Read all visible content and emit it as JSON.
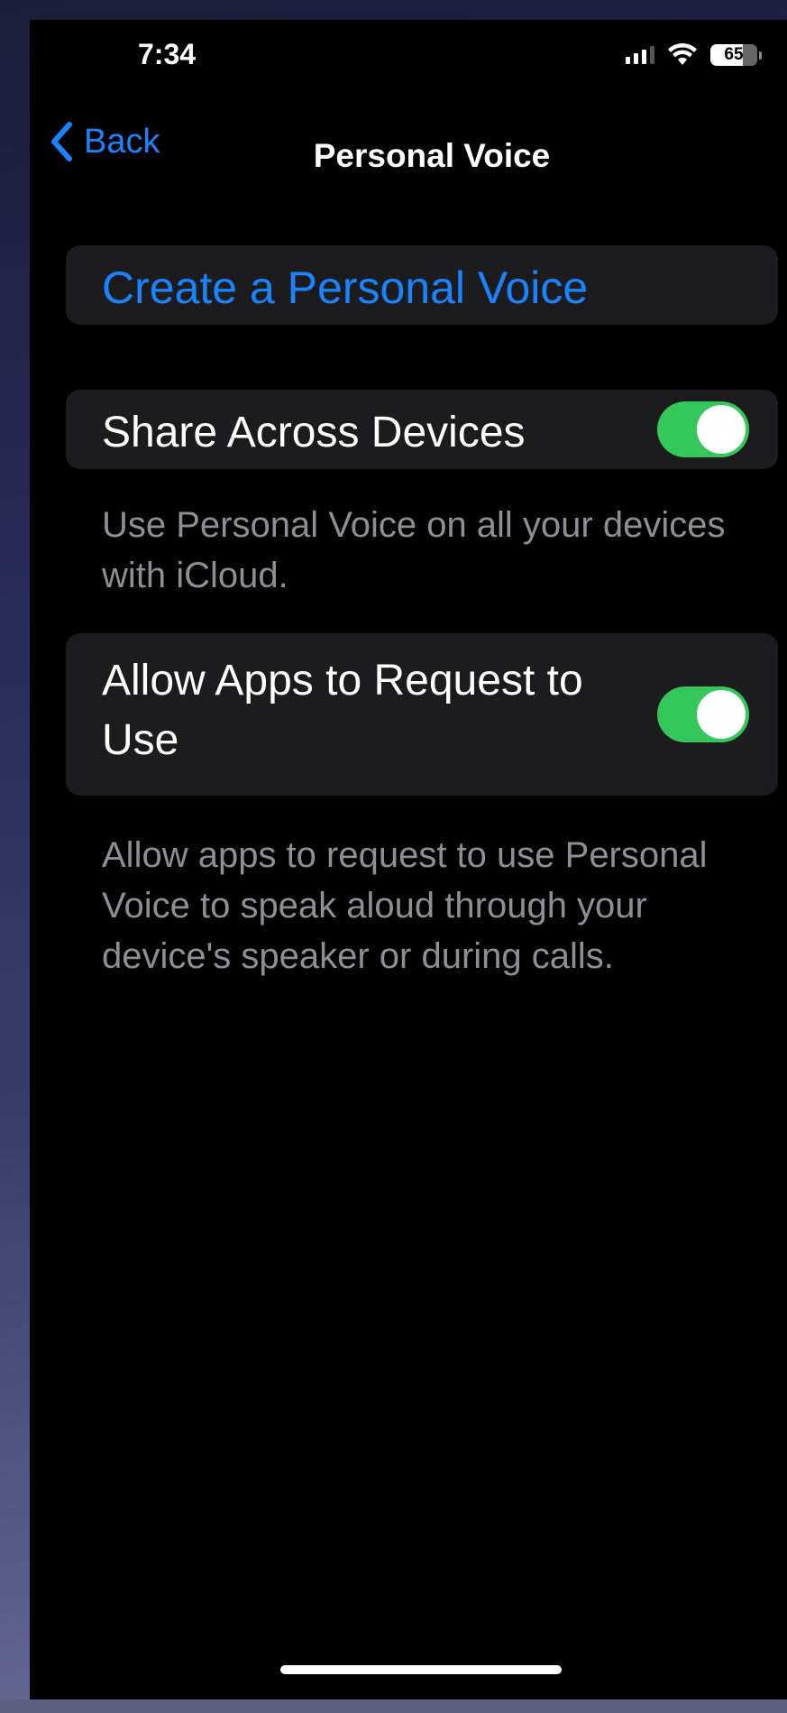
{
  "status_bar": {
    "time": "7:34",
    "battery": "65",
    "icons": [
      "cellular-signal-icon",
      "wifi-icon",
      "battery-icon"
    ]
  },
  "nav": {
    "back_label": "Back",
    "title": "Personal Voice"
  },
  "create": {
    "label": "Create a Personal Voice"
  },
  "share": {
    "label": "Share Across Devices",
    "enabled": true,
    "note": "Use Personal Voice on all your devices with iCloud."
  },
  "allow": {
    "label": "Allow Apps to Request to Use",
    "enabled": true,
    "note": "Allow apps to request to use Personal Voice to speak aloud through your device's speaker or during calls."
  },
  "colors": {
    "accent": "#1a84ff",
    "toggle_on": "#34c759",
    "group_bg": "#1c1c1e",
    "note_text": "#8e8e93"
  }
}
